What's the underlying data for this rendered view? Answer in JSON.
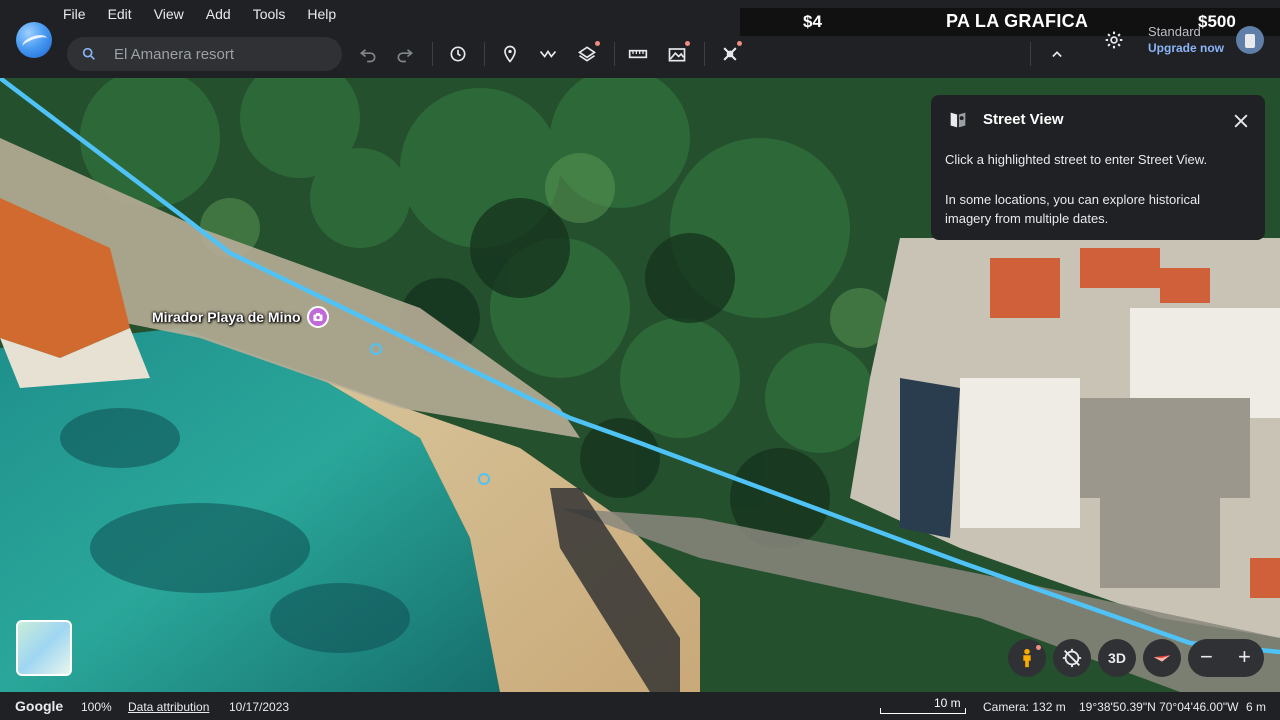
{
  "menu": [
    "File",
    "Edit",
    "View",
    "Add",
    "Tools",
    "Help"
  ],
  "search": {
    "placeholder": "El Amanera resort"
  },
  "toolbar": {
    "icons": [
      "undo-icon",
      "redo-icon",
      "history-icon",
      "placemark-icon",
      "path-icon",
      "layers-icon",
      "measure-icon",
      "image-overlay-icon",
      "projects-icon",
      "collapse-icon"
    ]
  },
  "banner": {
    "left_amount": "$4",
    "title": "PA LA GRAFICA",
    "right_amount": "$500"
  },
  "account": {
    "plan": "Standard",
    "upgrade": "Upgrade now"
  },
  "map": {
    "poi_label": "Mirador Playa de Mino",
    "route_color": "#4fc3f7",
    "poi_color": "#c26ad9"
  },
  "street_view": {
    "title": "Street View",
    "line1": "Click a highlighted street to enter Street View.",
    "line2": "In some locations, you can explore historical imagery from multiple dates."
  },
  "controls": {
    "three_d": "3D",
    "zoom_out": "−",
    "zoom_in": "+"
  },
  "status": {
    "brand": "Google",
    "zoom": "100%",
    "attribution": "Data attribution",
    "date": "10/17/2023",
    "scale": "10 m",
    "camera": "Camera: 132 m",
    "coords": "19°38'50.39\"N 70°04'46.00\"W",
    "elevation": "6 m"
  }
}
